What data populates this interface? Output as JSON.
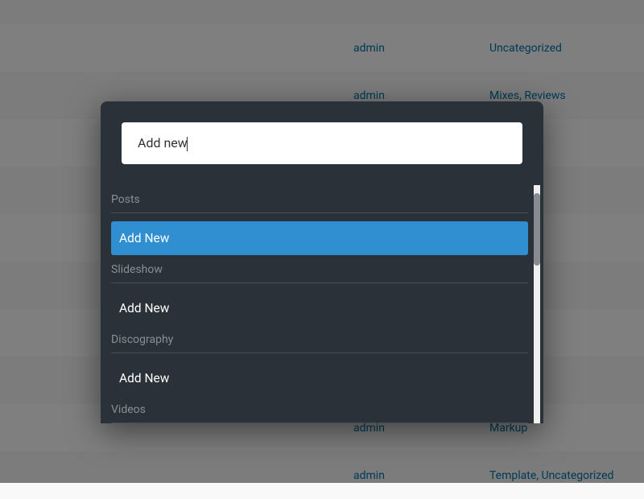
{
  "bg_rows": [
    {
      "author": "",
      "cats": ""
    },
    {
      "author": "admin",
      "cats": "Uncategorized"
    },
    {
      "author": "admin",
      "cats": "Mixes, Reviews"
    },
    {
      "author": "",
      "cats": ""
    },
    {
      "author": "",
      "cats": ""
    },
    {
      "author": "",
      "cats": ""
    },
    {
      "author": "",
      "cats": ""
    },
    {
      "author": "",
      "cats": ""
    },
    {
      "author": "",
      "cats": ""
    },
    {
      "author": "admin",
      "cats": "Markup"
    },
    {
      "author": "admin",
      "cats": "Template, Uncategorized"
    }
  ],
  "palette": {
    "search_value": "Add new",
    "groups": [
      {
        "header": "Posts",
        "items": [
          {
            "label": "Add New",
            "selected": true
          }
        ]
      },
      {
        "header": "Slideshow",
        "items": [
          {
            "label": "Add New",
            "selected": false
          }
        ]
      },
      {
        "header": "Discography",
        "items": [
          {
            "label": "Add New",
            "selected": false
          }
        ]
      },
      {
        "header": "Videos",
        "items": []
      }
    ]
  }
}
